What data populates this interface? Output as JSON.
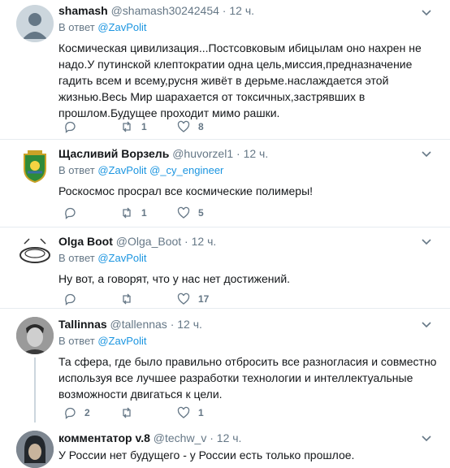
{
  "reply_prefix": "В ответ",
  "tweets": [
    {
      "name": "shamash",
      "handle": "@shamash30242454",
      "time": "12 ч.",
      "mentions": [
        "@ZavPolit"
      ],
      "text": "Космическая цивилизация...Постсовковым ибицылам оно нахрен не надо.У путинской клептократии одна цель,миссия,предназначение гадить всем и всему,русня живёт в дерьме.наслаждается этой жизнью.Весь Мир шарахается от токсичных,застрявших в прошлом.Будущее проходит мимо рашки.",
      "replies": "",
      "retweets": "1",
      "likes": "8"
    },
    {
      "name": "Щасливий Ворзель",
      "handle": "@huvorzel1",
      "time": "12 ч.",
      "mentions": [
        "@ZavPolit",
        "@_cy_engineer"
      ],
      "text": "Роскосмос просрал все космические полимеры!",
      "replies": "",
      "retweets": "1",
      "likes": "5"
    },
    {
      "name": "Olga Boot",
      "handle": "@Olga_Boot",
      "time": "12 ч.",
      "mentions": [
        "@ZavPolit"
      ],
      "text": "Ну вот, а говорят, что у нас нет достижений.",
      "replies": "",
      "retweets": "",
      "likes": "17"
    },
    {
      "name": "Tallinnas",
      "handle": "@tallennas",
      "time": "12 ч.",
      "mentions": [
        "@ZavPolit"
      ],
      "text": "Та сфера, где было правильно отбросить все разногласия и совместно используя все лучшее разработки технологии и интеллектуальные возможности двигаться к цели.",
      "replies": "2",
      "retweets": "",
      "likes": "1"
    },
    {
      "name": "комментатор v.8",
      "handle": "@techw_v",
      "time": "12 ч.",
      "mentions": [],
      "text": "У России нет будущего - у России есть только прошлое."
    }
  ]
}
